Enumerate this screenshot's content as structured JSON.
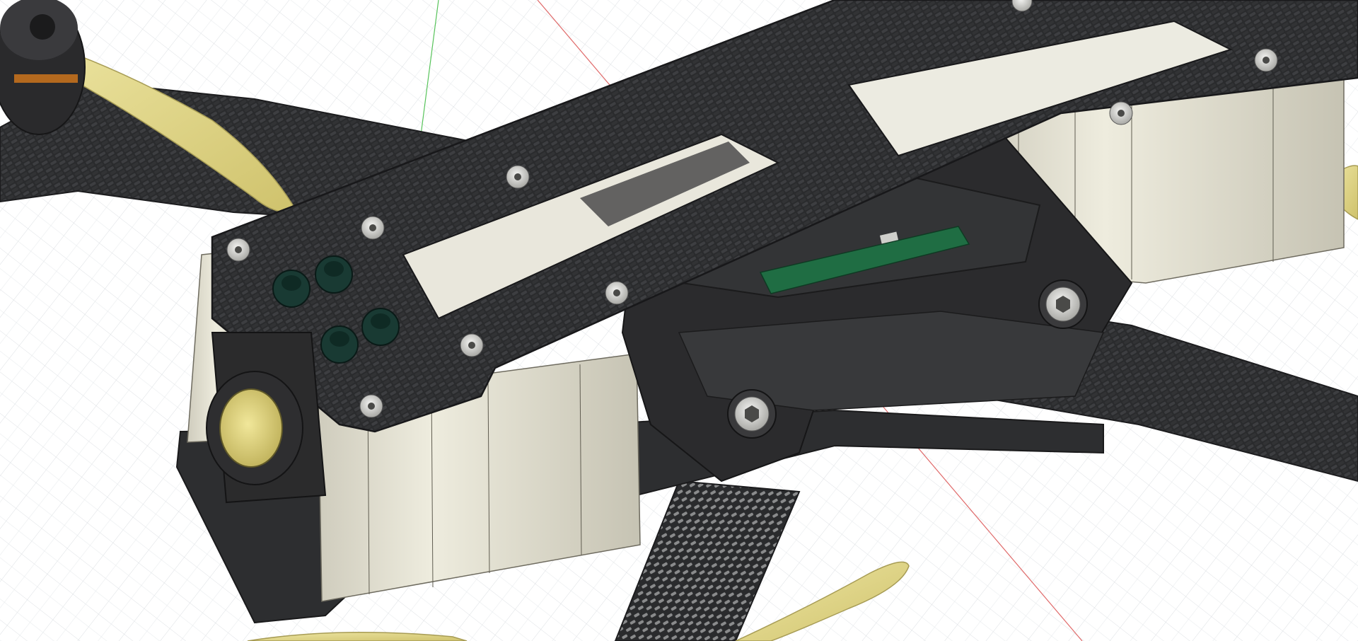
{
  "viewport": {
    "kind": "3d-cad-viewport",
    "background_color": "#ffffff",
    "grid_color": "#c9ced3",
    "axis_colors": {
      "x": "#e06a6a",
      "y": "#57c35a"
    }
  },
  "model": {
    "subject": "fpv-drone-frame",
    "colors": {
      "carbon_fiber": "#2c2d2f",
      "carbon_weave_light": "#3b3c3f",
      "standoff": "#e1dfd2",
      "tpu_mount": "#2b2b2d",
      "propeller": "#e3d98a",
      "pcb": "#1f6d43",
      "fastener": "#d9d9d6",
      "camera_lens": "#e2d675"
    },
    "parts": [
      "top-plate",
      "bottom-plate",
      "arm-front-left",
      "arm-rear-left",
      "arm-rear-right",
      "aluminum-standoff",
      "flight-controller-pcb",
      "tpu-stack-mount",
      "fpv-camera",
      "propeller",
      "motor",
      "button-head-screw",
      "socket-head-screw",
      "camera-mount-nut"
    ]
  }
}
